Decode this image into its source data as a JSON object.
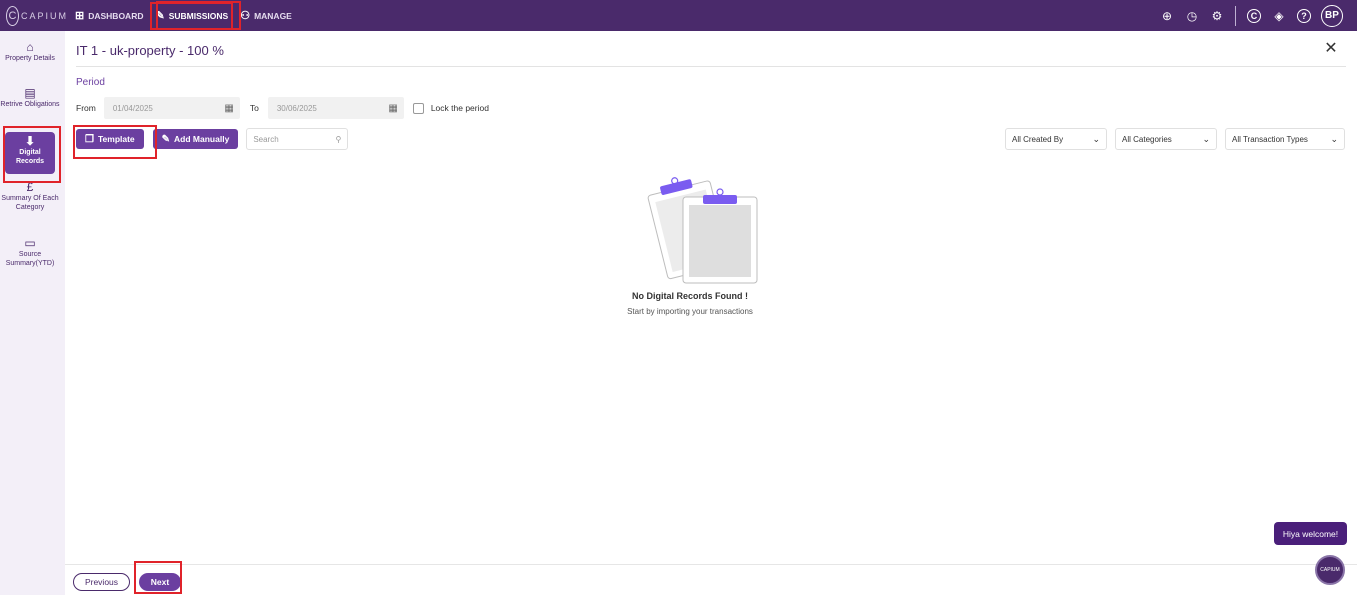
{
  "topbar": {
    "logo_text": "CAPIUM",
    "logo_glyph": "C",
    "nav": [
      {
        "label": "DASHBOARD",
        "icon": "dashboard-icon",
        "glyph": "⊞"
      },
      {
        "label": "SUBMISSIONS",
        "icon": "pencil-icon",
        "glyph": "✎"
      },
      {
        "label": "MANAGE",
        "icon": "manage-users-icon",
        "glyph": "⚇"
      }
    ],
    "icons": [
      {
        "name": "add-circle-icon",
        "glyph": "⊕"
      },
      {
        "name": "history-clock-icon",
        "glyph": "◷"
      },
      {
        "name": "settings-gear-icon",
        "glyph": "⚙"
      },
      {
        "name": "capium-apps-icon",
        "glyph": "C"
      },
      {
        "name": "integrations-icon",
        "glyph": "◈"
      },
      {
        "name": "help-icon",
        "glyph": "?"
      }
    ],
    "avatar": "BP"
  },
  "sidebar": {
    "items": [
      {
        "label": "Property Details",
        "icon": "home-icon",
        "glyph": "⌂"
      },
      {
        "label": "Retrive Obligations",
        "icon": "document-icon",
        "glyph": "▤"
      },
      {
        "label": "Digital Records",
        "icon": "download-icon",
        "glyph": "⬇"
      },
      {
        "label": "Summary Of Each Category",
        "icon": "pound-icon",
        "glyph": "£"
      },
      {
        "label": "Source Summary(YTD)",
        "icon": "folder-icon",
        "glyph": "▭"
      }
    ]
  },
  "main": {
    "title": "IT 1 - uk-property - 100 %",
    "close_glyph": "✕",
    "period_label": "Period",
    "from_label": "From",
    "from_placeholder": "01/04/2025",
    "to_label": "To",
    "to_placeholder": "30/06/2025",
    "lock_label": "Lock the period",
    "template_label": "Template",
    "add_manually_label": "Add Manually",
    "search_placeholder": "Search",
    "filters": [
      "All Created By",
      "All Categories",
      "All Transaction Types"
    ],
    "empty_title": "No Digital Records Found !",
    "empty_subtitle": "Start by importing your transactions",
    "previous_label": "Previous",
    "next_label": "Next"
  },
  "chat": {
    "bubble": "Hiya welcome!",
    "launcher_text": "CAPIUM"
  },
  "colors": {
    "topbar": "#4a2a6b",
    "accent": "#6b3fa0",
    "highlight": "#e0232a",
    "sidebar_bg": "#f3eff8"
  }
}
